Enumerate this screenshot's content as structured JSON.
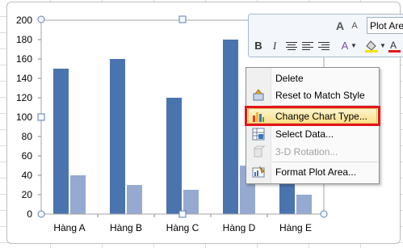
{
  "chart_data": {
    "type": "bar",
    "categories": [
      "Hàng A",
      "Hàng B",
      "Hàng C",
      "Hàng D",
      "Hàng E"
    ],
    "series": [
      {
        "values": [
          150,
          160,
          120,
          180,
          90
        ]
      },
      {
        "values": [
          40,
          30,
          25,
          50,
          20
        ]
      }
    ],
    "y_ticks": [
      "0",
      "20",
      "40",
      "60",
      "80",
      "100",
      "120",
      "140",
      "160",
      "180",
      "200"
    ],
    "ylim": [
      0,
      200
    ],
    "grid": false,
    "colors": [
      "#4a74ae",
      "#95a9d1"
    ]
  },
  "mini_toolbar": {
    "font_name": "Plot Area",
    "bold": "B",
    "italic": "I",
    "grow_font": "A",
    "shrink_font": "A",
    "font_color": "A"
  },
  "context_menu": {
    "items": [
      {
        "label": "Delete",
        "icon": "none",
        "enabled": true
      },
      {
        "label": "Reset to Match Style",
        "icon": "reset-style-icon",
        "enabled": true
      },
      {
        "label": "Change Chart Type...",
        "icon": "change-chart-type-icon",
        "enabled": true,
        "highlighted": true
      },
      {
        "label": "Select Data...",
        "icon": "select-data-icon",
        "enabled": true
      },
      {
        "label": "3-D Rotation...",
        "icon": "3d-rotation-icon",
        "enabled": false
      },
      {
        "label": "Format Plot Area...",
        "icon": "format-plot-area-icon",
        "enabled": true
      }
    ]
  },
  "colors": {
    "highlight_border": "#e3151a",
    "series1": "#4a74ae",
    "series2": "#95a9d1"
  }
}
